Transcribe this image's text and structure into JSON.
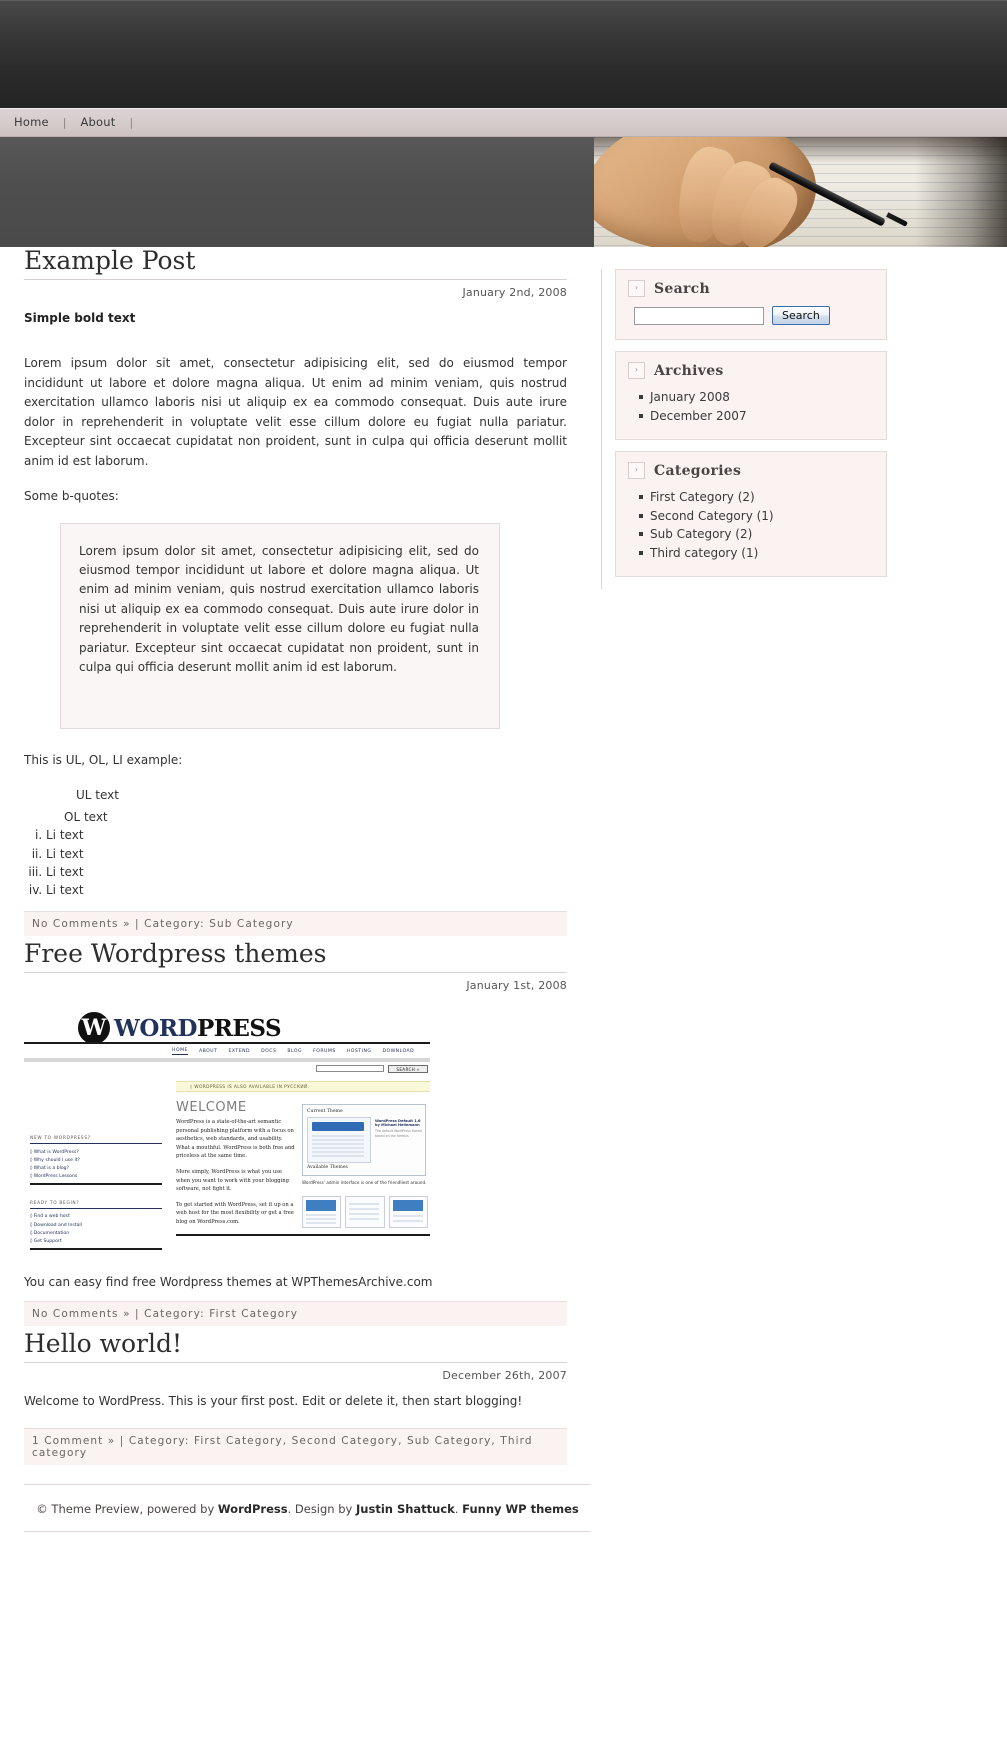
{
  "nav": {
    "items": [
      {
        "label": "Home"
      },
      {
        "label": "About"
      }
    ],
    "separator": "|"
  },
  "posts": [
    {
      "title": "Example Post",
      "date": "January 2nd, 2008",
      "lead_bold": "Simple bold text",
      "paragraph": "Lorem ipsum dolor sit amet, consectetur adipisicing elit, sed do eiusmod tempor incididunt ut labore et dolore magna aliqua. Ut enim ad minim veniam, quis nostrud exercitation ullamco laboris nisi ut aliquip ex ea commodo consequat. Duis aute irure dolor in reprehenderit in voluptate velit esse cillum dolore eu fugiat nulla pariatur. Excepteur sint occaecat cupidatat non proident, sunt in culpa qui officia deserunt mollit anim id est laborum.",
      "bquote_intro": "Some b-quotes:",
      "blockquote": "Lorem ipsum dolor sit amet, consectetur adipisicing elit, sed do eiusmod tempor incididunt ut labore et dolore magna aliqua. Ut enim ad minim veniam, quis nostrud exercitation ullamco laboris nisi ut aliquip ex ea commodo consequat. Duis aute irure dolor in reprehenderit in voluptate velit esse cillum dolore eu fugiat nulla pariatur. Excepteur sint occaecat cupidatat non proident, sunt in culpa qui officia deserunt mollit anim id est laborum.",
      "list_intro": "This is UL, OL, LI example:",
      "ul_text": "UL text",
      "ol_text": "OL text",
      "li_items": [
        "Li text",
        "Li text",
        "Li text",
        "Li text"
      ],
      "meta_comments": "No Comments »",
      "meta_sep": "|",
      "meta_category": "Category: Sub Category"
    },
    {
      "title": "Free Wordpress themes",
      "date": "January 1st, 2008",
      "caption": "You can easy find free Wordpress themes at WPThemesArchive.com",
      "meta_comments": "No Comments »",
      "meta_sep": "|",
      "meta_category": "Category: First Category"
    },
    {
      "title": "Hello world!",
      "date": "December 26th, 2007",
      "body": "Welcome to WordPress. This is your first post. Edit or delete it, then start blogging!",
      "meta_comments": "1 Comment »",
      "meta_sep": "|",
      "meta_category": "Category: First Category, Second Category, Sub Category, Third category"
    }
  ],
  "wp_screenshot": {
    "logo_word": "WORD",
    "logo_word2": "PRESS",
    "logo_mark": "W",
    "nav": [
      "HOME",
      "ABOUT",
      "EXTEND",
      "DOCS",
      "BLOG",
      "FORUMS",
      "HOSTING",
      "DOWNLOAD"
    ],
    "search_button": "SEARCH »",
    "notice": "◊ WORDPRESS IS ALSO AVAILABLE IN РУССКИЙ.",
    "welcome": "WELCOME",
    "left_col": [
      {
        "heading": "NEW TO WORDPRESS?",
        "links": [
          "◊ What is WordPress?",
          "◊ Why should I use it?",
          "◊ What is a blog?",
          "◊ WordPress Lessons"
        ]
      },
      {
        "heading": "READY TO BEGIN?",
        "links": [
          "◊ Find a web host",
          "◊ Download and Install",
          "◊ Documentation",
          "◊ Get Support"
        ]
      }
    ],
    "mid_col": [
      "WordPress is a state-of-the-art semantic personal publishing platform with a focus on aesthetics, web standards, and usability. What a mouthful. WordPress is both free and priceless at the same time.",
      "More simply, WordPress is what you use when you want to work with your blogging software, not fight it.",
      "To get started with WordPress, set it up on a web host for the most flexibility or get a free blog on WordPress.com."
    ],
    "panel_title": "Current Theme",
    "panel_title2": "Available Themes",
    "panel_side_title": "WordPress Default 1.6 by Michael Heilemann",
    "panel_side_desc": "The default WordPress theme based on the famous",
    "caption": "WordPress' admin interface is one of the friendliest around."
  },
  "sidebar": {
    "widgets": [
      {
        "title": "Search",
        "chevron": "›",
        "type": "search",
        "input_value": "",
        "input_placeholder": "",
        "button_label": "Search"
      },
      {
        "title": "Archives",
        "chevron": "›",
        "type": "list",
        "items": [
          "January 2008",
          "December 2007"
        ]
      },
      {
        "title": "Categories",
        "chevron": "›",
        "type": "list",
        "items": [
          "First Category (2)",
          "Second Category (1)",
          "Sub Category (2)",
          "Third category (1)"
        ]
      }
    ]
  },
  "footer": {
    "prefix": "© Theme Preview, powered by ",
    "wordpress": "WordPress",
    "mid": ". Design by ",
    "author": "Justin Shattuck",
    "dot": ". ",
    "themes": "Funny WP themes"
  },
  "colors": {
    "masthead": "#3a3a3a",
    "navbar": "#d4cbcb",
    "banner": "#4e4e4e",
    "widget_bg": "#fbf2f2",
    "meta_bg": "#fbf2f2",
    "accent_blue": "#21325b"
  }
}
